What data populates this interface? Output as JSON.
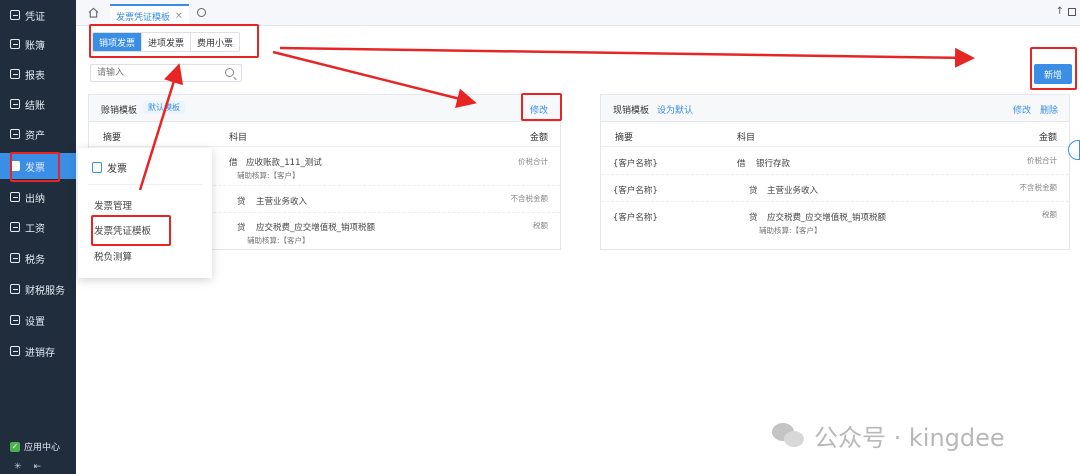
{
  "sidebar": {
    "items": [
      {
        "label": "凭证"
      },
      {
        "label": "账簿"
      },
      {
        "label": "报表"
      },
      {
        "label": "结账"
      },
      {
        "label": "资产"
      },
      {
        "label": "发票"
      },
      {
        "label": "出纳"
      },
      {
        "label": "工资"
      },
      {
        "label": "税务"
      },
      {
        "label": "财税服务"
      },
      {
        "label": "设置"
      },
      {
        "label": "进销存"
      }
    ],
    "app_center": "应用中心",
    "collapse_glyph": "⇤",
    "settings_glyph": "✳"
  },
  "tabbar": {
    "active_tab": "发票凭证模板",
    "close_glyph": "×",
    "up_glyph": "↑"
  },
  "segments": [
    "销项发票",
    "进项发票",
    "费用小票"
  ],
  "search": {
    "placeholder": "请输入"
  },
  "new_button": "新增",
  "card_left": {
    "title": "赊销模板",
    "tag": "默认模板",
    "edit": "修改",
    "columns": {
      "summary": "摘要",
      "subject": "科目",
      "amount": "金额"
    },
    "rows": [
      {
        "dc": "借",
        "subject": "应收账款_111_测试",
        "aux": "辅助核算:【客户】",
        "amount": "价税合计"
      },
      {
        "dc": "贷",
        "subject": "主营业务收入",
        "aux": "",
        "amount": "不含税金额"
      },
      {
        "dc": "贷",
        "subject": "应交税费_应交增值税_销项税额",
        "aux": "辅助核算:【客户】",
        "amount": "税额"
      }
    ]
  },
  "card_right": {
    "title": "现销模板",
    "set_default": "设为默认",
    "edit": "修改",
    "delete": "删除",
    "columns": {
      "summary": "摘要",
      "subject": "科目",
      "amount": "金额"
    },
    "rows": [
      {
        "summary": "{客户名称}",
        "dc": "借",
        "subject": "银行存款",
        "aux": "",
        "amount": "价税合计"
      },
      {
        "summary": "{客户名称}",
        "dc": "贷",
        "subject": "主营业务收入",
        "aux": "",
        "amount": "不含税金额"
      },
      {
        "summary": "{客户名称}",
        "dc": "贷",
        "subject": "应交税费_应交增值税_销项税额",
        "aux": "辅助核算:【客户】",
        "amount": "税额"
      }
    ]
  },
  "menu": {
    "title": "发票",
    "items": [
      "发票管理",
      "发票凭证模板",
      "税负测算"
    ]
  },
  "watermark": "公众号 · kingdee",
  "colors": {
    "accent": "#3a8ee6",
    "sidebar": "#1f2d3d",
    "annotation": "#e82525"
  }
}
